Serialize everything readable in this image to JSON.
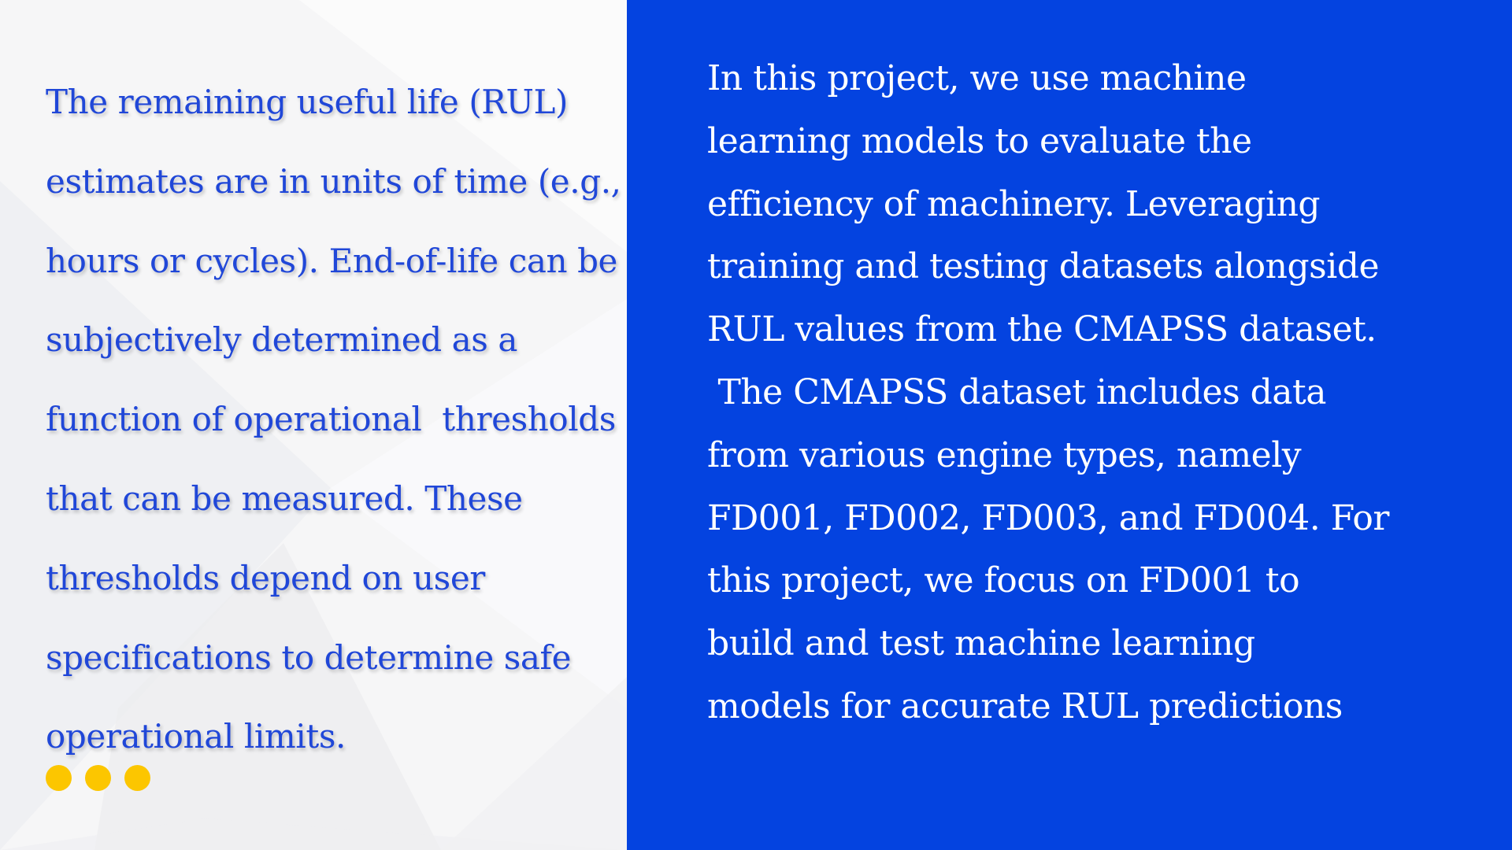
{
  "colors": {
    "left_background": "#f6f6f7",
    "left_text": "#2047d8",
    "right_background": "#0443e0",
    "right_text": "#ffffff",
    "dot_color": "#fcc600"
  },
  "left_paragraph": {
    "lines": [
      "The remaining useful life (RUL)",
      "estimates are in units of time (e.g.,",
      "hours or cycles). End-of-life can be",
      "subjectively determined as a",
      "function of operational  thresholds",
      "that can be measured. These",
      "thresholds depend on user",
      "specifications to determine safe",
      "operational limits."
    ]
  },
  "decorative_dots": {
    "count": 3
  },
  "right_paragraph": {
    "lines": [
      "In this project, we use machine",
      "learning models to evaluate the",
      "efficiency of machinery. Leveraging",
      "training and testing datasets alongside",
      "RUL values from the CMAPSS dataset.",
      " The CMAPSS dataset includes data",
      "from various engine types, namely",
      "FD001, FD002, FD003, and FD004. For",
      "this project, we focus on FD001 to",
      "build and test machine learning",
      "models for accurate RUL predictions"
    ]
  }
}
